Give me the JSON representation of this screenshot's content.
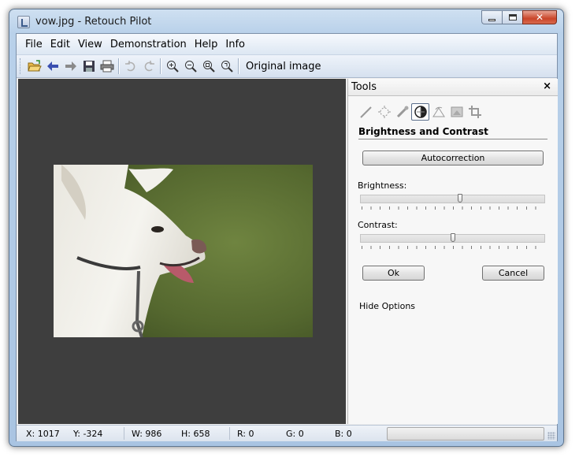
{
  "window": {
    "title": "vow.jpg - Retouch Pilot"
  },
  "menu": {
    "items": [
      "File",
      "Edit",
      "View",
      "Demonstration",
      "Help",
      "Info"
    ]
  },
  "toolbar": {
    "original_label": "Original image"
  },
  "tools": {
    "title": "Tools",
    "close": "×",
    "section_title": "Brightness and Contrast",
    "autocorrection_label": "Autocorrection",
    "brightness_label": "Brightness:",
    "brightness_value": 0.54,
    "contrast_label": "Contrast:",
    "contrast_value": 0.5,
    "ok_label": "Ok",
    "cancel_label": "Cancel",
    "hide_options": "Hide Options"
  },
  "status": {
    "x": "X: 1017",
    "y": "Y: -324",
    "w": "W: 986",
    "h": "H: 658",
    "r": "R: 0",
    "g": "G: 0",
    "b": "B: 0"
  }
}
